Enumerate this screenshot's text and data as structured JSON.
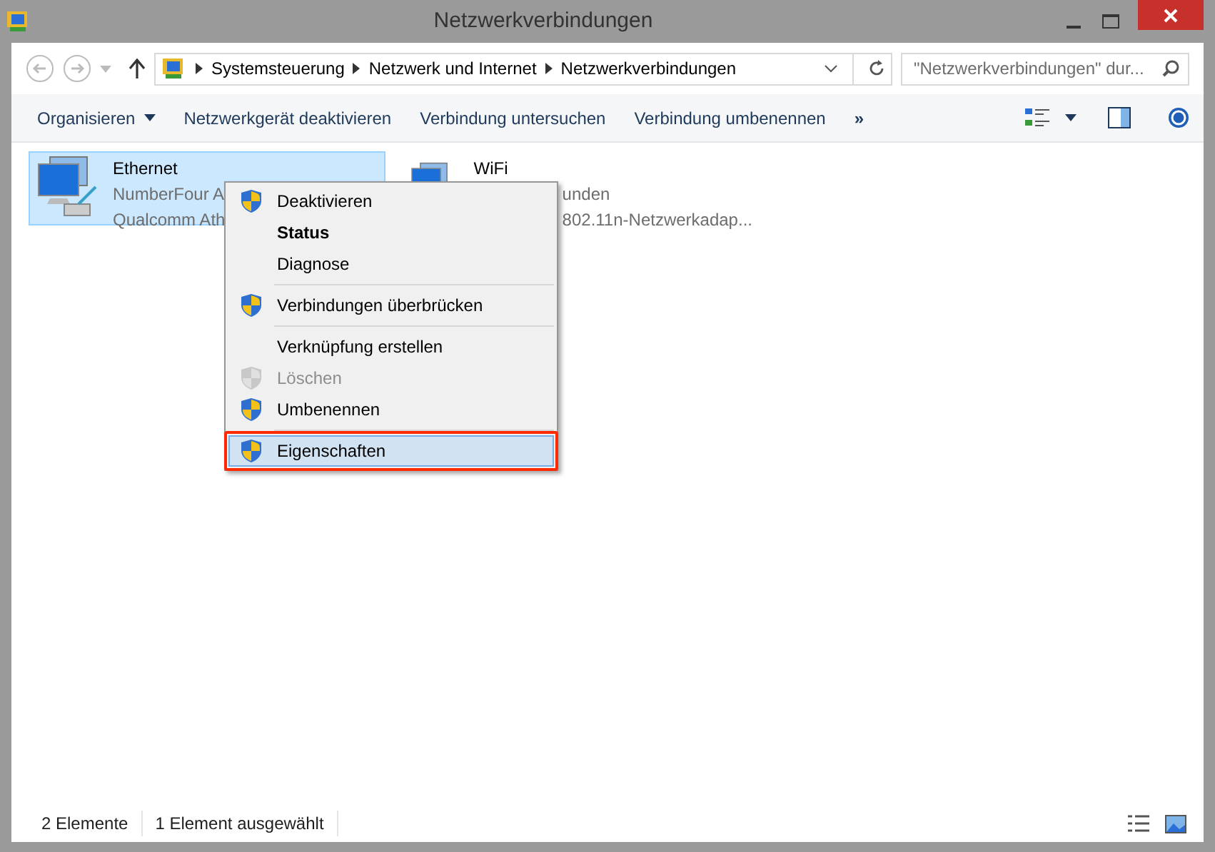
{
  "window": {
    "title": "Netzwerkverbindungen"
  },
  "address_bar": {
    "breadcrumbs": [
      "Systemsteuerung",
      "Netzwerk und Internet",
      "Netzwerkverbindungen"
    ]
  },
  "search": {
    "placeholder": "\"Netzwerkverbindungen\" dur..."
  },
  "toolbar": {
    "items": [
      {
        "label": "Organisieren",
        "dropdown": true
      },
      {
        "label": "Netzwerkgerät deaktivieren",
        "dropdown": false
      },
      {
        "label": "Verbindung untersuchen",
        "dropdown": false
      },
      {
        "label": "Verbindung umbenennen",
        "dropdown": false
      }
    ],
    "overflow": "»"
  },
  "connections": [
    {
      "name": "Ethernet",
      "lines": [
        "NumberFour A",
        "Qualcomm Ath"
      ],
      "selected": true,
      "kind": "wired"
    },
    {
      "name": "WiFi",
      "lines": [
        "unden",
        "802.11n-Netzwerkadap..."
      ],
      "selected": false,
      "kind": "wireless"
    }
  ],
  "context_menu": {
    "items": [
      {
        "kind": "item",
        "label": "Deaktivieren",
        "shield": true,
        "bold": false,
        "disabled": false,
        "selected": false
      },
      {
        "kind": "item",
        "label": "Status",
        "shield": false,
        "bold": true,
        "disabled": false,
        "selected": false
      },
      {
        "kind": "item",
        "label": "Diagnose",
        "shield": false,
        "bold": false,
        "disabled": false,
        "selected": false
      },
      {
        "kind": "separator"
      },
      {
        "kind": "item",
        "label": "Verbindungen überbrücken",
        "shield": true,
        "bold": false,
        "disabled": false,
        "selected": false
      },
      {
        "kind": "separator"
      },
      {
        "kind": "item",
        "label": "Verknüpfung erstellen",
        "shield": false,
        "bold": false,
        "disabled": false,
        "selected": false
      },
      {
        "kind": "item",
        "label": "Löschen",
        "shield": true,
        "bold": false,
        "disabled": true,
        "selected": false
      },
      {
        "kind": "item",
        "label": "Umbenennen",
        "shield": true,
        "bold": false,
        "disabled": false,
        "selected": false
      },
      {
        "kind": "separator"
      },
      {
        "kind": "item",
        "label": "Eigenschaften",
        "shield": true,
        "bold": false,
        "disabled": false,
        "selected": true
      }
    ]
  },
  "status_bar": {
    "items": [
      "2 Elemente",
      "1 Element ausgewählt"
    ]
  }
}
